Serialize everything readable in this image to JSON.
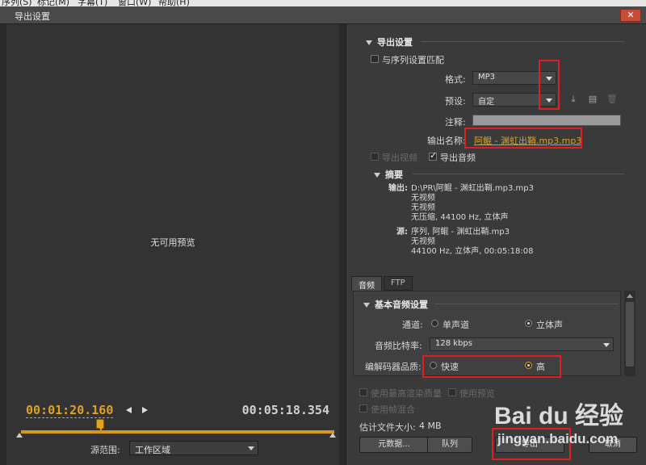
{
  "dialog": {
    "title": "导出设置",
    "close_label": "✕"
  },
  "preview": {
    "no_preview": "无可用预览",
    "current_timecode": "00:01:20.160",
    "end_timecode": "00:05:18.354",
    "source_range_label": "源范围:",
    "source_range_value": "工作区域"
  },
  "export_settings": {
    "heading": "导出设置",
    "match_sequence_label": "与序列设置匹配",
    "format_label": "格式:",
    "format_value": "MP3",
    "preset_label": "预设:",
    "preset_value": "自定",
    "comment_label": "注释:",
    "comment_value": "",
    "output_name_label": "输出名称:",
    "output_name_value": "阿鲲 - 渊虹出鞘.mp3.mp3",
    "export_video_label": "导出视频",
    "export_audio_label": "导出音频",
    "export_video_checked": false,
    "export_audio_checked": true
  },
  "summary": {
    "heading": "摘要",
    "output_label": "输出:",
    "output_lines": [
      "D:\\PR\\阿鲲 - 渊虹出鞘.mp3.mp3",
      "无视频",
      "无视频",
      "无压缩, 44100 Hz, 立体声"
    ],
    "source_label": "源:",
    "source_lines": [
      "序列, 阿鲲 - 渊虹出鞘.mp3",
      "无视频",
      "44100 Hz, 立体声, 00:05:18:08"
    ]
  },
  "tabs": [
    {
      "label": "音频",
      "active": true
    },
    {
      "label": "FTP",
      "active": false
    }
  ],
  "audio": {
    "basic_heading": "基本音频设置",
    "channels_label": "通道:",
    "mono_label": "单声道",
    "stereo_label": "立体声",
    "channels_selected": "立体声",
    "bitrate_label": "音频比特率:",
    "bitrate_value": "128 kbps",
    "codec_quality_label": "编解码器品质:",
    "fast_label": "快速",
    "high_label": "高",
    "codec_quality_selected": "高"
  },
  "bottom": {
    "max_render_label": "使用最高渲染质量",
    "use_preview_label": "使用预览",
    "frame_blend_label": "使用帧混合",
    "file_size_label": "估计文件大小:",
    "file_size_value": "4 MB",
    "metadata_button": "元数据...",
    "queue_button": "队列",
    "export_button": "导出",
    "cancel_button": "取消"
  },
  "watermark": {
    "logo_text": "Bai du 经验",
    "site_text": "jingyan.baidu.com"
  },
  "colors": {
    "accent": "#e0a020",
    "highlight_box": "#e02020",
    "panel": "#3a3a3a",
    "preview_bg": "#333333"
  }
}
